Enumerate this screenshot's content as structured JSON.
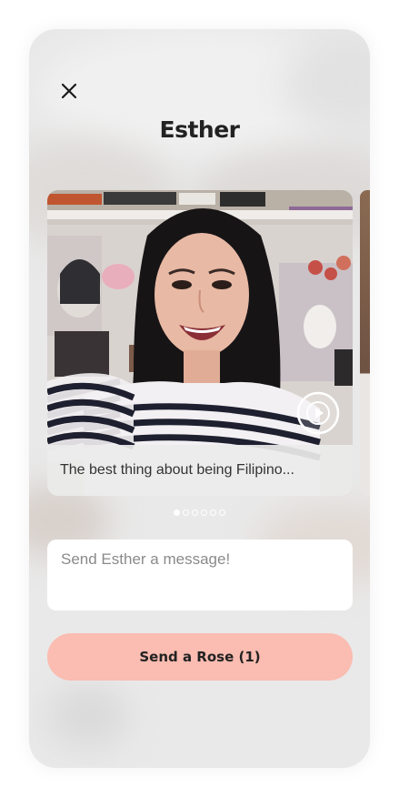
{
  "profile": {
    "name": "Esther"
  },
  "card": {
    "caption": "The best thing about being Filipino...",
    "media_icon": "play-icon"
  },
  "carousel": {
    "total": 6,
    "active_index": 0
  },
  "message": {
    "placeholder": "Send Esther a message!",
    "value": ""
  },
  "action": {
    "rose_label": "Send a Rose (1)"
  },
  "icons": {
    "close": "close-icon"
  },
  "colors": {
    "accent": "#fbbcb1",
    "title": "#222222",
    "background": "#e9e9e9"
  }
}
